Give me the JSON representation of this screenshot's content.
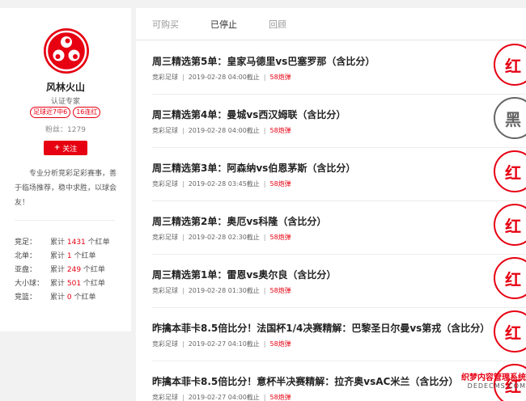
{
  "profile": {
    "name": "风林火山",
    "cert": "认证专家",
    "tags": [
      "足球近7中6",
      "16连红"
    ],
    "fans": "粉丝：1279",
    "follow_label": "关注",
    "description": "专业分析竞彩足彩赛事，善于临场推荐，稳中求胜，以球会友！",
    "stats": [
      {
        "label": "竞足：",
        "prefix": "累计 ",
        "count": "1431",
        "suffix": " 个红单"
      },
      {
        "label": "北单：",
        "prefix": "累计 ",
        "count": "1",
        "suffix": " 个红单"
      },
      {
        "label": "亚盘：",
        "prefix": "累计 ",
        "count": "249",
        "suffix": " 个红单"
      },
      {
        "label": "大小球：",
        "prefix": "累计 ",
        "count": "501",
        "suffix": " 个红单"
      },
      {
        "label": "竞篮：",
        "prefix": "累计 ",
        "count": "0",
        "suffix": " 个红单"
      }
    ]
  },
  "tabs": [
    "可购买",
    "已停止",
    "回顾"
  ],
  "items": [
    {
      "title": "周三精选第5单：皇家马德里vs巴塞罗那（含比分）",
      "category": "竞彩足球",
      "deadline": "2019-02-28 04:00截止",
      "price": "58炮弹",
      "result": "红"
    },
    {
      "title": "周三精选第4单：曼城vs西汉姆联（含比分）",
      "category": "竞彩足球",
      "deadline": "2019-02-28 04:00截止",
      "price": "58炮弹",
      "result": "黑"
    },
    {
      "title": "周三精选第3单：阿森纳vs伯恩茅斯（含比分）",
      "category": "竞彩足球",
      "deadline": "2019-02-28 03:45截止",
      "price": "58炮弹",
      "result": "红"
    },
    {
      "title": "周三精选第2单：奥厄vs科隆（含比分）",
      "category": "竞彩足球",
      "deadline": "2019-02-28 02:30截止",
      "price": "58炮弹",
      "result": "红"
    },
    {
      "title": "周三精选第1单：雷恩vs奥尔良（含比分）",
      "category": "竞彩足球",
      "deadline": "2019-02-28 01:30截止",
      "price": "58炮弹",
      "result": "红"
    },
    {
      "title": "昨擒本菲卡8.5倍比分！法国杯1/4决赛精解：巴黎圣日尔曼vs第戎（含比分）",
      "category": "竞彩足球",
      "deadline": "2019-02-27 04:10截止",
      "price": "58炮弹",
      "result": "红"
    },
    {
      "title": "昨擒本菲卡8.5倍比分！意杯半决赛精解：拉齐奥vsAC米兰（含比分）",
      "category": "竞彩足球",
      "deadline": "2019-02-27 04:00截止",
      "price": "58炮弹",
      "result": "红"
    }
  ],
  "watermark": {
    "line1": "织梦内容管理系统",
    "line2": "DEDECMS.COM"
  },
  "colors": {
    "accent": "#e60012",
    "lose": "#666666"
  },
  "icons": {
    "avatar": "three-tomoe-crest-icon",
    "stamp": "result-stamp-icon"
  }
}
